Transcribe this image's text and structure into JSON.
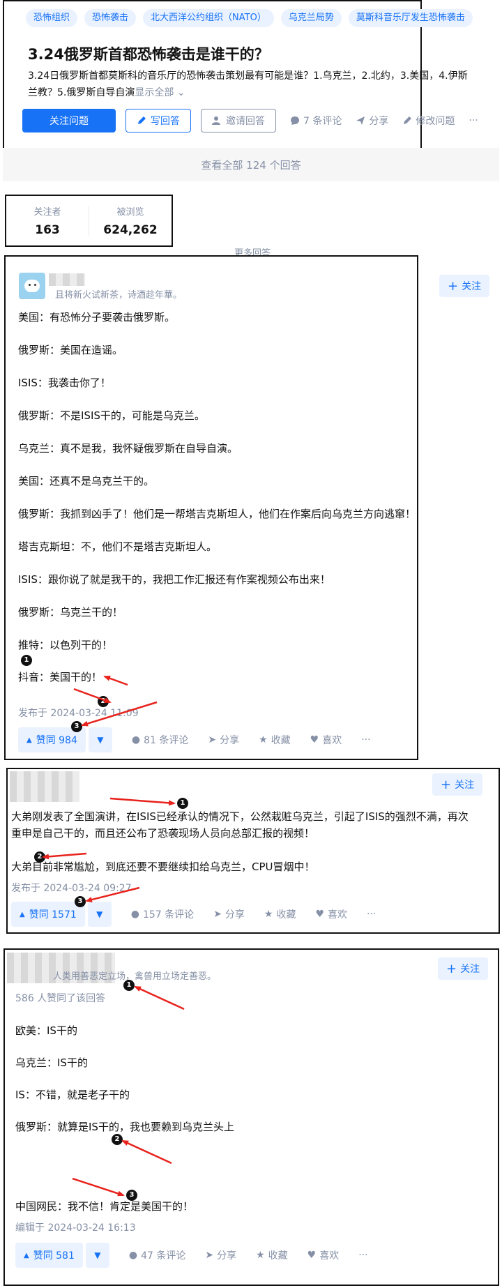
{
  "question": {
    "tags": [
      "恐怖组织",
      "恐怖袭击",
      "北大西洋公约组织（NATO）",
      "乌克兰局势",
      "莫斯科音乐厅发生恐怖袭击"
    ],
    "title": "3.24俄罗斯首都恐怖袭击是谁干的？",
    "desc_line1": "3.24日俄罗斯首都莫斯科的音乐厅的恐怖袭击策划最有可能是谁？1.乌克兰，2.北约，3.美国，4.伊斯",
    "desc_line2": "兰教？5.俄罗斯自导自演",
    "show_all": "显示全部",
    "follow_label": "关注问题",
    "write_label": "写回答",
    "invite_label": "邀请回答",
    "comments_label": "7 条评论",
    "share_label": "分享",
    "edit_label": "修改问题",
    "more_label": "···",
    "view_all_label": "查看全部 124 个回答"
  },
  "stats": {
    "followers_label": "关注者",
    "followers_value": "163",
    "views_label": "被浏览",
    "views_value": "624,262"
  },
  "more_answers_label": "更多回答",
  "answers": [
    {
      "bio": "且将新火试新茶，诗酒趁年華。",
      "follow_label": "关注",
      "lines": [
        "美国：有恐怖分子要袭击俄罗斯。",
        "俄罗斯：美国在造谣。",
        "ISIS：我袭击你了！",
        "俄罗斯：不是ISIS干的，可能是乌克兰。",
        "乌克兰：真不是我，我怀疑俄罗斯在自导自演。",
        "美国：还真不是乌克兰干的。",
        "俄罗斯：我抓到凶手了！他们是一帮塔吉克斯坦人，他们在作案后向乌克兰方向逃窜！",
        "塔吉克斯坦：不，他们不是塔吉克斯坦人。",
        "ISIS：跟你说了就是我干的，我把工作汇报还有作案视频公布出来！",
        "俄罗斯：乌克兰干的！",
        "推特：以色列干的！",
        "抖音：美国干的！"
      ],
      "time": "发布于 2024-03-24 11:09",
      "vote_label": "赞同 984",
      "comments_label": "81 条评论",
      "share_label": "分享",
      "collect_label": "收藏",
      "like_label": "喜欢",
      "more_label": "···"
    },
    {
      "follow_label": "关注",
      "lines": [
        "大弟刚发表了全国演讲，在ISIS已经承认的情况下，公然栽赃乌克兰，引起了ISIS的强烈不满，再次",
        "重申是自己干的，而且还公布了恐袭现场人员向总部汇报的视频！",
        "大弟目前非常尴尬，到底还要不要继续扣给乌克兰，CPU冒烟中！"
      ],
      "time": "发布于 2024-03-24 09:27",
      "vote_label": "赞同 1571",
      "comments_label": "157 条评论",
      "share_label": "分享",
      "collect_label": "收藏",
      "like_label": "喜欢",
      "more_label": "···"
    },
    {
      "bio": "人类用善恶定立场，禽兽用立场定善恶。",
      "follow_label": "关注",
      "upvoters": "586 人赞同了该回答",
      "lines": [
        "欧美：IS干的",
        "乌克兰：IS干的",
        "IS：不错，就是老子干的",
        "俄罗斯：就算是IS干的，我也要赖到乌克兰头上",
        "中国网民：我不信！肯定是美国干的！"
      ],
      "time": "编辑于 2024-03-24 16:13",
      "vote_label": "赞同 581",
      "comments_label": "47 条评论",
      "share_label": "分享",
      "collect_label": "收藏",
      "like_label": "喜欢",
      "more_label": "···"
    }
  ],
  "markers": [
    "1",
    "2",
    "3"
  ],
  "colors": {
    "accent": "#1772f6",
    "meta": "#8590a6",
    "arrow": "#e8221c"
  }
}
